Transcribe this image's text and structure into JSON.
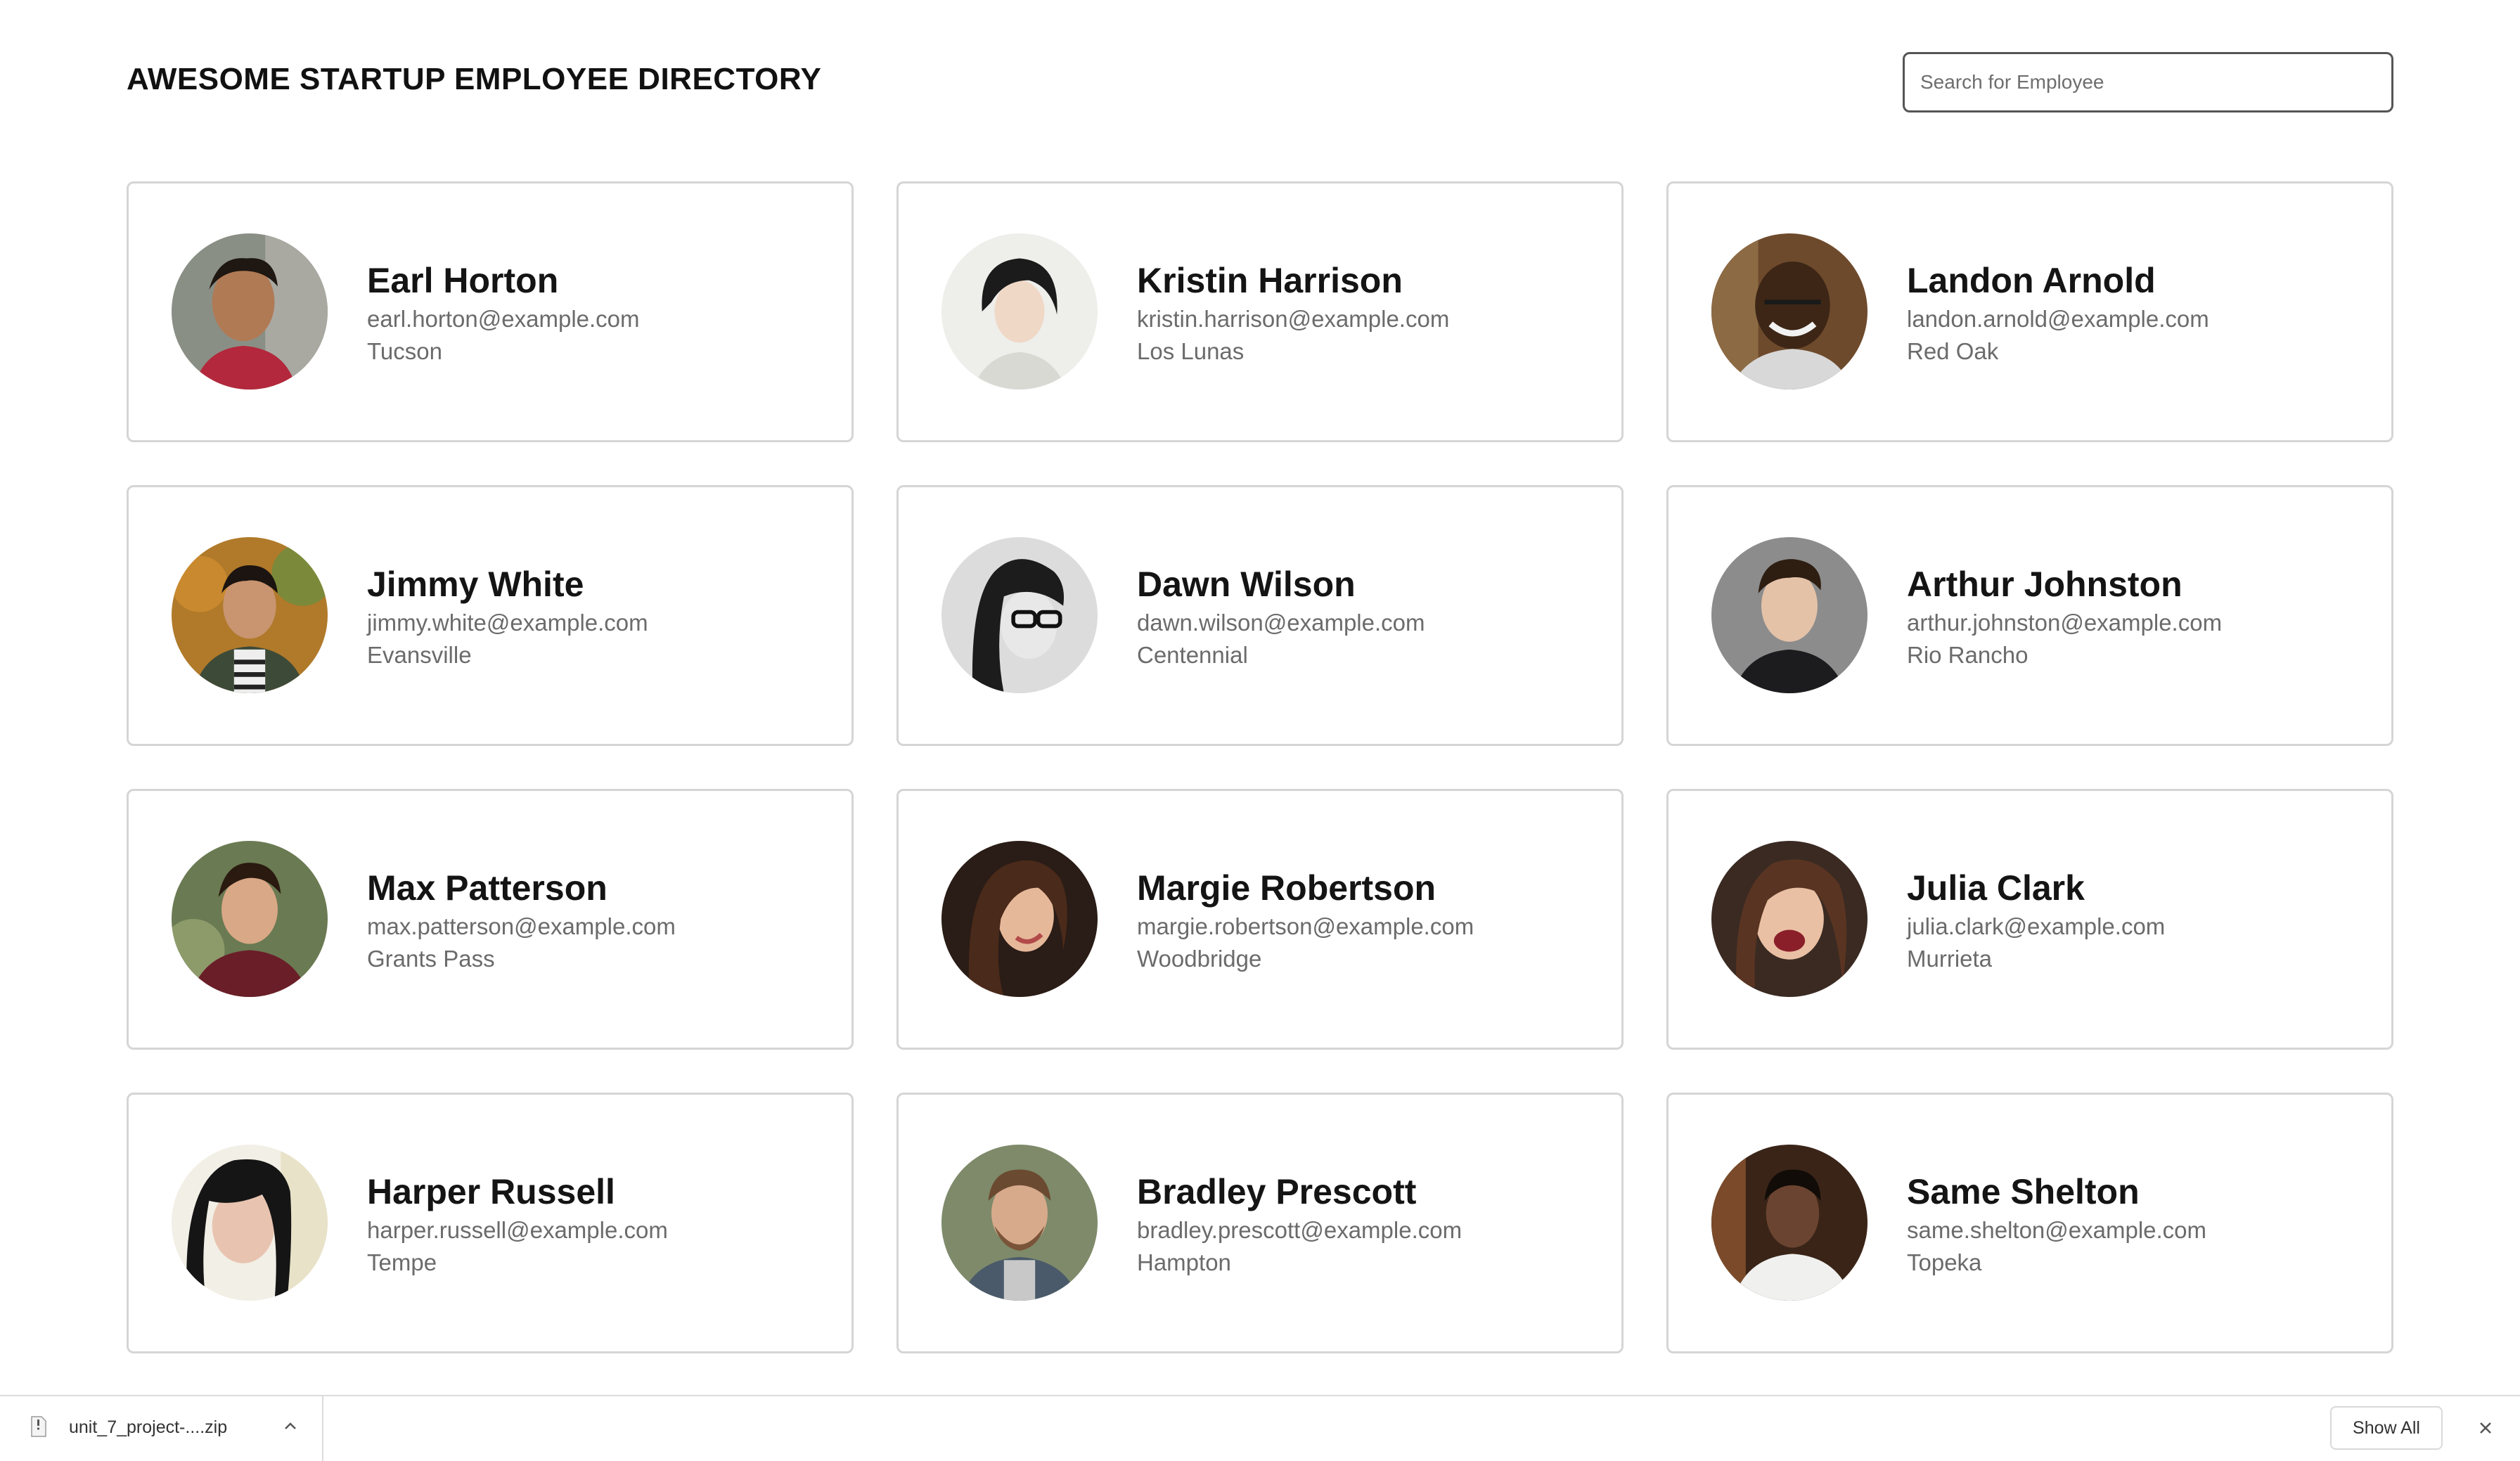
{
  "header": {
    "title": "AWESOME STARTUP EMPLOYEE DIRECTORY",
    "search_placeholder": "Search for Employee"
  },
  "employees": [
    {
      "name": "Earl Horton",
      "email": "earl.horton@example.com",
      "city": "Tucson"
    },
    {
      "name": "Kristin Harrison",
      "email": "kristin.harrison@example.com",
      "city": "Los Lunas"
    },
    {
      "name": "Landon Arnold",
      "email": "landon.arnold@example.com",
      "city": "Red Oak"
    },
    {
      "name": "Jimmy White",
      "email": "jimmy.white@example.com",
      "city": "Evansville"
    },
    {
      "name": "Dawn Wilson",
      "email": "dawn.wilson@example.com",
      "city": "Centennial"
    },
    {
      "name": "Arthur Johnston",
      "email": "arthur.johnston@example.com",
      "city": "Rio Rancho"
    },
    {
      "name": "Max Patterson",
      "email": "max.patterson@example.com",
      "city": "Grants Pass"
    },
    {
      "name": "Margie Robertson",
      "email": "margie.robertson@example.com",
      "city": "Woodbridge"
    },
    {
      "name": "Julia Clark",
      "email": "julia.clark@example.com",
      "city": "Murrieta"
    },
    {
      "name": "Harper Russell",
      "email": "harper.russell@example.com",
      "city": "Tempe"
    },
    {
      "name": "Bradley Prescott",
      "email": "bradley.prescott@example.com",
      "city": "Hampton"
    },
    {
      "name": "Same Shelton",
      "email": "same.shelton@example.com",
      "city": "Topeka"
    }
  ],
  "download_bar": {
    "filename": "unit_7_project-....zip",
    "show_all_label": "Show All"
  },
  "icons": {
    "file": "file-icon",
    "chevron": "chevron-up-icon",
    "close": "close-icon"
  },
  "colors": {
    "card_border": "#d5d5d5",
    "text_primary": "#141414",
    "text_secondary": "#6b6b6b",
    "search_border": "#555555"
  }
}
